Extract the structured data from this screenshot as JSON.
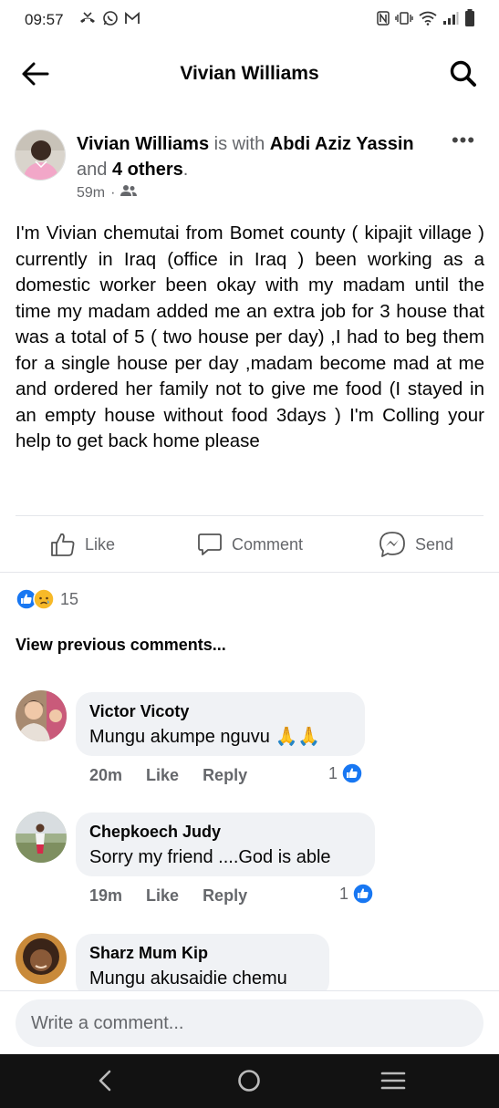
{
  "status_bar": {
    "time": "09:57",
    "left_icons": [
      "missed-call-icon",
      "whatsapp-icon",
      "gmail-icon"
    ],
    "right_icons": [
      "nfc-icon",
      "vibrate-icon",
      "wifi-icon",
      "signal-icon",
      "battery-icon"
    ]
  },
  "header": {
    "title": "Vivian Williams",
    "back_icon": "back-arrow-icon",
    "search_icon": "search-icon"
  },
  "post": {
    "author": "Vivian Williams",
    "with_text": " is with ",
    "tagged": "Abdi Aziz Yassin",
    "and_text": " and ",
    "others": "4 others",
    "period": ".",
    "time": "59m",
    "dot": "·",
    "audience_icon": "friends-icon",
    "more_label": "•••",
    "body": "I'm Vivian chemutai from Bomet county ( kipajit village ) currently in Iraq (office in Iraq ) been working as a domestic worker been okay with my madam until the time my madam added me an extra job for 3 house that was a total of 5 ( two house per day) ,I had to beg them for a single house per day ,madam become mad at me and ordered her family not to give me food (I stayed in an empty house without food 3days ) I'm Colling your help to get back home please"
  },
  "actions": {
    "like": "Like",
    "comment": "Comment",
    "send": "Send"
  },
  "reactions": {
    "types": [
      "like",
      "sad"
    ],
    "count": "15"
  },
  "view_previous": "View previous comments...",
  "comments": [
    {
      "name": "Victor Vicoty",
      "text": "Mungu akumpe nguvu 🙏🙏",
      "time": "20m",
      "like": "Like",
      "reply": "Reply",
      "likes": "1"
    },
    {
      "name": "Chepkoech Judy",
      "text": "Sorry my friend ....God is able",
      "time": "19m",
      "like": "Like",
      "reply": "Reply",
      "likes": "1"
    },
    {
      "name": "Sharz Mum Kip",
      "text": "Mungu akusaidie chemu"
    }
  ],
  "composer": {
    "placeholder": "Write a comment..."
  },
  "nav_bar": {
    "icons": [
      "nav-back-icon",
      "nav-home-icon",
      "nav-recents-icon"
    ]
  },
  "colors": {
    "facebook_blue": "#1877f2",
    "secondary_text": "#65676b",
    "bubble_bg": "#f0f2f5"
  }
}
